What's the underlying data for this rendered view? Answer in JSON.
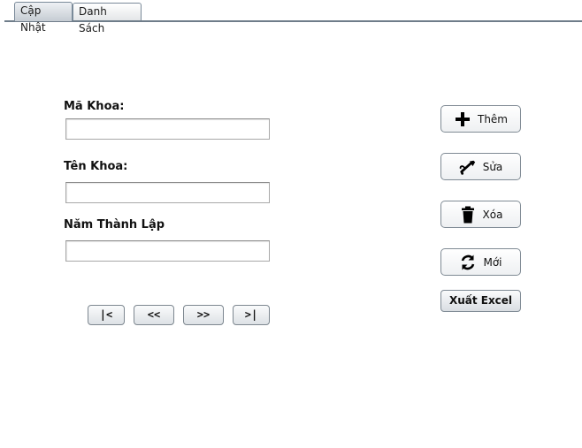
{
  "tabs": {
    "update_label": "Cập Nhật",
    "list_label": "Danh Sách"
  },
  "form": {
    "ma_khoa_label": "Mã Khoa:",
    "ma_khoa_value": "",
    "ten_khoa_label": "Tên Khoa:",
    "ten_khoa_value": "",
    "nam_thanh_lap_label": "Năm Thành Lập",
    "nam_thanh_lap_value": ""
  },
  "navigation": {
    "first": "|<",
    "previous": "<<",
    "next": ">>",
    "last": ">|"
  },
  "actions": {
    "add_label": "Thêm",
    "add_icon": "plus-icon",
    "edit_label": "Sửa",
    "edit_icon": "edit-tool-icon",
    "delete_label": "Xóa",
    "delete_icon": "trash-icon",
    "new_label": "Mới",
    "new_icon": "refresh-icon",
    "export_excel_label": "Xuất Excel"
  },
  "colors": {
    "tab_active_bg": "#c5ccd3",
    "border": "#7f8a94",
    "icon": "#000000"
  }
}
